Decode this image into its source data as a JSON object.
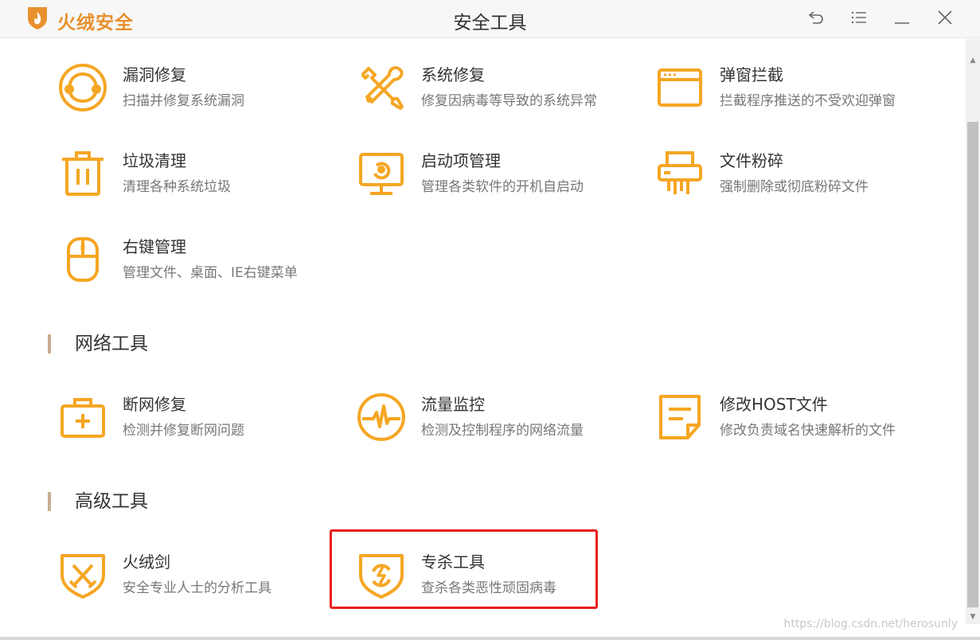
{
  "app": {
    "name": "火绒安全",
    "window_title": "安全工具"
  },
  "tools": [
    {
      "name": "漏洞修复",
      "desc": "扫描并修复系统漏洞",
      "icon": "vuln-repair-icon"
    },
    {
      "name": "系统修复",
      "desc": "修复因病毒等导致的系统异常",
      "icon": "wrench-screwdriver-icon"
    },
    {
      "name": "弹窗拦截",
      "desc": "拦截程序推送的不受欢迎弹窗",
      "icon": "popup-window-icon"
    },
    {
      "name": "垃圾清理",
      "desc": "清理各种系统垃圾",
      "icon": "trash-icon"
    },
    {
      "name": "启动项管理",
      "desc": "管理各类软件的开机自启动",
      "icon": "monitor-startup-icon"
    },
    {
      "name": "文件粉碎",
      "desc": "强制删除或彻底粉碎文件",
      "icon": "shredder-icon"
    },
    {
      "name": "右键管理",
      "desc": "管理文件、桌面、IE右键菜单",
      "icon": "mouse-icon"
    }
  ],
  "sections": {
    "network": "网络工具",
    "advanced": "高级工具"
  },
  "network_tools": [
    {
      "name": "断网修复",
      "desc": "检测并修复断网问题",
      "icon": "medkit-icon"
    },
    {
      "name": "流量监控",
      "desc": "检测及控制程序的网络流量",
      "icon": "traffic-monitor-icon"
    },
    {
      "name": "修改HOST文件",
      "desc": "修改负责域名快速解析的文件",
      "icon": "note-icon"
    }
  ],
  "advanced_tools": [
    {
      "name": "火绒剑",
      "desc": "安全专业人士的分析工具",
      "icon": "sword-shield-icon"
    },
    {
      "name": "专杀工具",
      "desc": "查杀各类恶性顽固病毒",
      "icon": "shield-lightning-icon"
    }
  ],
  "watermark": "https://blog.csdn.net/herosunly",
  "colors": {
    "accent": "#f5a623",
    "brand": "#e8912c",
    "highlight": "#ea1e1e",
    "section_bar": "#c7ad8f"
  }
}
